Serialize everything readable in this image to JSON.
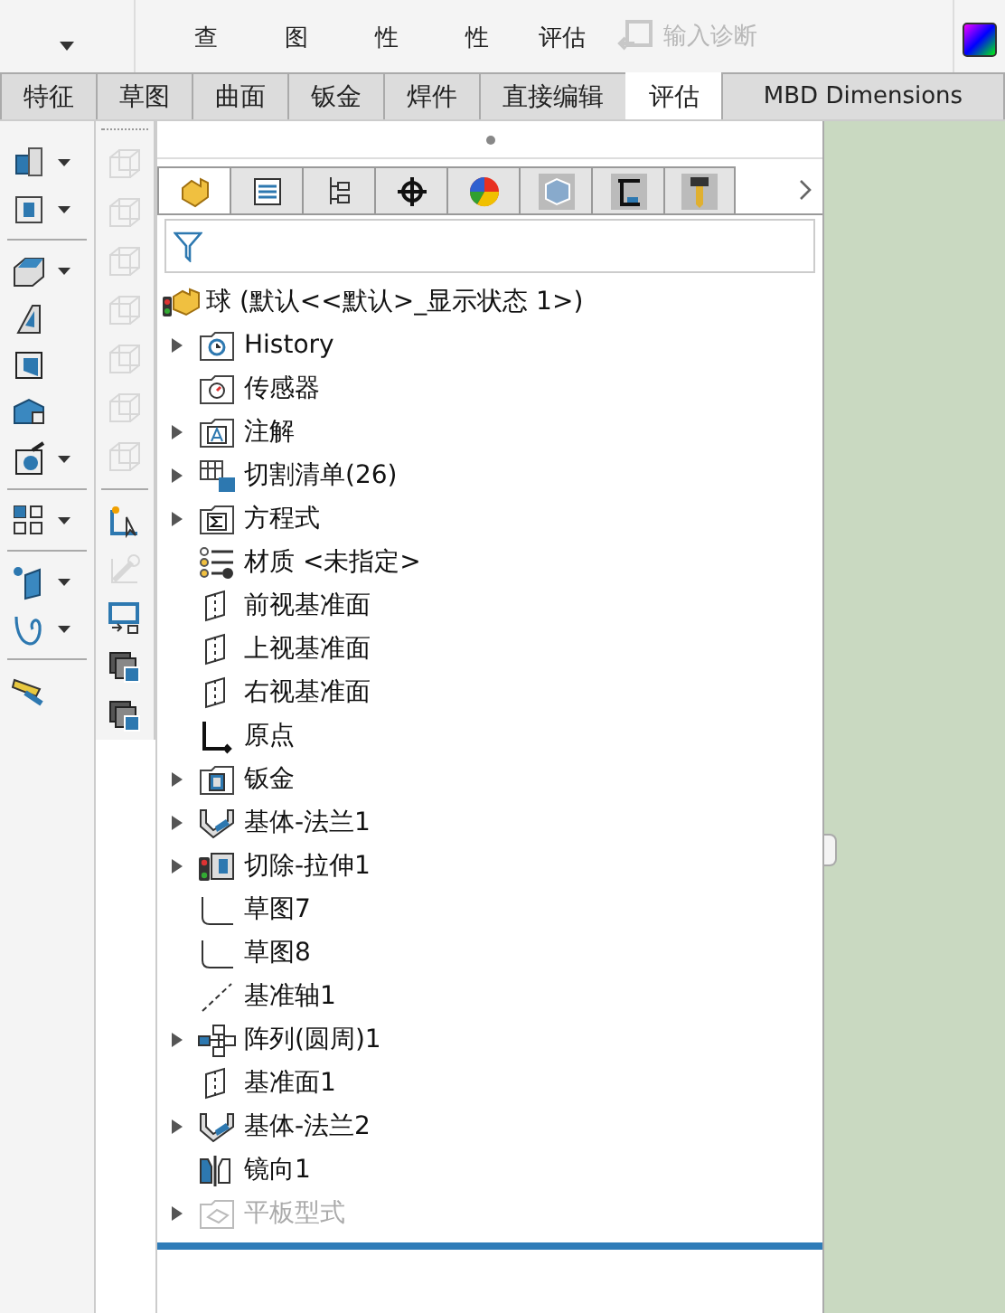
{
  "ribbon": {
    "items": [
      {
        "label": "查",
        "disabled": false
      },
      {
        "label": "图",
        "disabled": false
      },
      {
        "label": "性",
        "disabled": false
      },
      {
        "label": "性",
        "disabled": false
      },
      {
        "label": "评估",
        "disabled": false
      },
      {
        "label": "输入诊断",
        "disabled": true
      }
    ]
  },
  "tabs": [
    {
      "label": "特征",
      "selected": false
    },
    {
      "label": "草图",
      "selected": false
    },
    {
      "label": "曲面",
      "selected": false
    },
    {
      "label": "钣金",
      "selected": false
    },
    {
      "label": "焊件",
      "selected": false
    },
    {
      "label": "直接编辑",
      "selected": false
    },
    {
      "label": "评估",
      "selected": true
    },
    {
      "label": "MBD Dimensions",
      "selected": false
    }
  ],
  "left_toolbar": [
    {
      "kind": "extrude",
      "dropdown": true
    },
    {
      "kind": "cut",
      "dropdown": true
    },
    {
      "kind": "fillet",
      "dropdown": true
    },
    {
      "kind": "rib",
      "dropdown": false
    },
    {
      "kind": "shell",
      "dropdown": false
    },
    {
      "kind": "chamfer",
      "dropdown": false
    },
    {
      "kind": "wrap",
      "dropdown": true
    },
    {
      "kind": "pattern",
      "dropdown": true
    },
    {
      "kind": "plane",
      "dropdown": true
    },
    {
      "kind": "curve",
      "dropdown": true
    },
    {
      "kind": "measure",
      "dropdown": false
    }
  ],
  "second_toolbar": [
    {
      "kind": "box",
      "disabled": true
    },
    {
      "kind": "box",
      "disabled": true
    },
    {
      "kind": "box",
      "disabled": true
    },
    {
      "kind": "box",
      "disabled": true
    },
    {
      "kind": "box",
      "disabled": true
    },
    {
      "kind": "box",
      "disabled": true
    },
    {
      "kind": "box",
      "disabled": true
    },
    {
      "kind": "sketch",
      "disabled": false
    },
    {
      "kind": "wrench",
      "disabled": true
    },
    {
      "kind": "screen",
      "disabled": false
    },
    {
      "kind": "stack",
      "disabled": false
    },
    {
      "kind": "stack",
      "disabled": false
    }
  ],
  "panel_tabs": [
    {
      "kind": "part",
      "selected": true
    },
    {
      "kind": "list",
      "selected": false
    },
    {
      "kind": "config",
      "selected": false
    },
    {
      "kind": "target",
      "selected": false
    },
    {
      "kind": "color",
      "selected": false
    },
    {
      "kind": "cube",
      "selected": false
    },
    {
      "kind": "cam",
      "selected": false
    },
    {
      "kind": "tool",
      "selected": false
    }
  ],
  "tree": {
    "label": "球 (默认<<默认>_显示状态 1>)",
    "kind": "part",
    "children": [
      {
        "label": "History",
        "kind": "history",
        "expandable": true,
        "disabled": false
      },
      {
        "label": "传感器",
        "kind": "sensor",
        "expandable": false,
        "disabled": false
      },
      {
        "label": "注解",
        "kind": "annotation",
        "expandable": true,
        "disabled": false
      },
      {
        "label": "切割清单(26)",
        "kind": "cutlist",
        "expandable": true,
        "disabled": false
      },
      {
        "label": "方程式",
        "kind": "equation",
        "expandable": true,
        "disabled": false
      },
      {
        "label": "材质 <未指定>",
        "kind": "material",
        "expandable": false,
        "disabled": false
      },
      {
        "label": "前视基准面",
        "kind": "plane",
        "expandable": false,
        "disabled": false
      },
      {
        "label": "上视基准面",
        "kind": "plane",
        "expandable": false,
        "disabled": false
      },
      {
        "label": "右视基准面",
        "kind": "plane",
        "expandable": false,
        "disabled": false
      },
      {
        "label": "原点",
        "kind": "origin",
        "expandable": false,
        "disabled": false
      },
      {
        "label": "钣金",
        "kind": "sheetmetal",
        "expandable": true,
        "disabled": false
      },
      {
        "label": "基体-法兰1",
        "kind": "flange",
        "expandable": true,
        "disabled": false
      },
      {
        "label": "切除-拉伸1",
        "kind": "cut",
        "expandable": true,
        "disabled": false
      },
      {
        "label": "草图7",
        "kind": "sketch",
        "expandable": false,
        "disabled": false
      },
      {
        "label": "草图8",
        "kind": "sketch",
        "expandable": false,
        "disabled": false
      },
      {
        "label": "基准轴1",
        "kind": "axis",
        "expandable": false,
        "disabled": false
      },
      {
        "label": "阵列(圆周)1",
        "kind": "pattern",
        "expandable": true,
        "disabled": false
      },
      {
        "label": "基准面1",
        "kind": "plane",
        "expandable": false,
        "disabled": false
      },
      {
        "label": "基体-法兰2",
        "kind": "flange",
        "expandable": true,
        "disabled": false
      },
      {
        "label": "镜向1",
        "kind": "mirror",
        "expandable": false,
        "disabled": false
      },
      {
        "label": "平板型式",
        "kind": "flat",
        "expandable": true,
        "disabled": true
      }
    ]
  }
}
